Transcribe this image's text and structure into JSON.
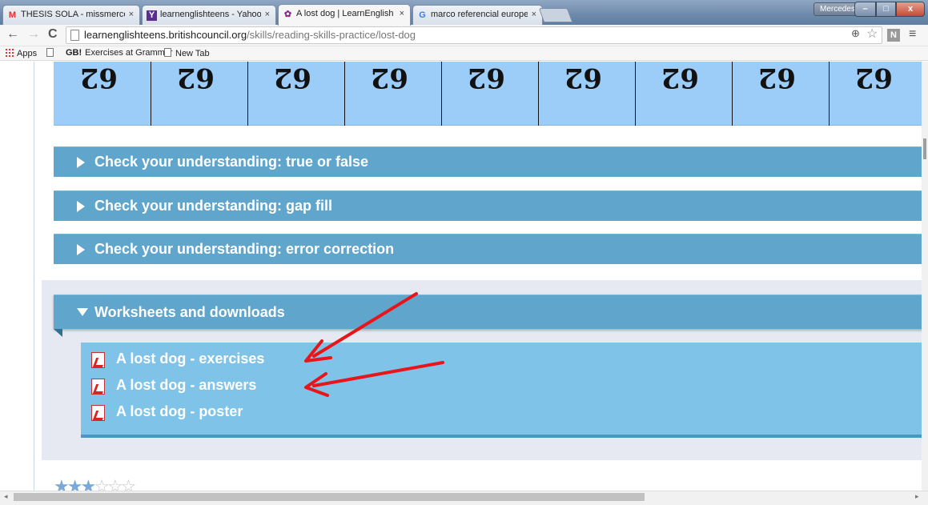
{
  "browser": {
    "tabs": [
      {
        "icon": "M",
        "title": "THESIS SOLA - missmerce"
      },
      {
        "icon": "Y",
        "title": "learnenglishteens - Yahoo"
      },
      {
        "icon": "✿",
        "title": "A lost dog | LearnEnglish"
      },
      {
        "icon": "G",
        "title": "marco referencial europe"
      }
    ],
    "tab_close": "×",
    "profile": "Mercedes",
    "window_buttons": {
      "minimize": "–",
      "maximize": "□",
      "close": "x"
    },
    "url_host": "learnenglishteens.britishcouncil.org",
    "url_path": "/skills/reading-skills-practice/lost-dog",
    "ext_label": "N"
  },
  "bookmarks": {
    "apps": "Apps",
    "gb_badge": "GB!",
    "grammar": "Exercises at Grammar",
    "newtab": "New Tab"
  },
  "ruler": {
    "numbers": [
      "62",
      "62",
      "62",
      "62",
      "62",
      "62",
      "62",
      "62",
      "62"
    ]
  },
  "accordions": [
    "Check your understanding: true or false",
    "Check your understanding: gap fill",
    "Check your understanding: error correction"
  ],
  "downloads": {
    "title": "Worksheets and downloads",
    "items": [
      "A lost dog - exercises",
      "A lost dog - answers",
      "A lost dog - poster"
    ]
  },
  "rating": {
    "value": 3,
    "max": 6
  },
  "colors": {
    "accent": "#5fa5cc",
    "ruler": "#9ccdf8",
    "arrow": "#e8151b"
  }
}
